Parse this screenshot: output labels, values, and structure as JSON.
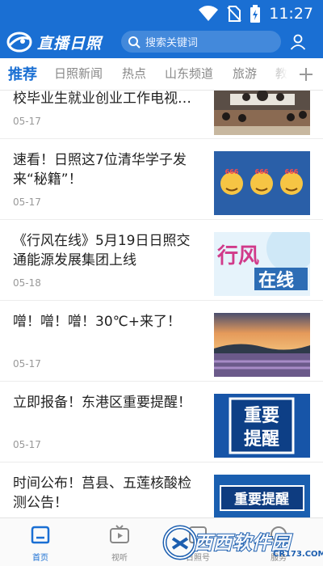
{
  "status_bar": {
    "time": "11:27"
  },
  "header": {
    "logo_text": "直播日照",
    "search_placeholder": "搜索关键词"
  },
  "tabs": [
    "推荐",
    "日照新闻",
    "热点",
    "山东频道",
    "旅游",
    "教"
  ],
  "feed": [
    {
      "title": "校毕业生就业创业工作电视…",
      "date": "05-17"
    },
    {
      "title": "速看！日照这7位清华学子发来“秘籍”！",
      "date": "05-17"
    },
    {
      "title": "《行风在线》5月19日日照交通能源发展集团上线",
      "date": "05-18"
    },
    {
      "title": "噌！噌！噌！30℃+来了！",
      "date": "05-17"
    },
    {
      "title": "立即报备！东港区重要提醒！",
      "date": "05-17"
    },
    {
      "title": "时间公布！莒县、五莲核酸检测公告！",
      "date": ""
    }
  ],
  "thumbnails": {
    "item2_badge": "666",
    "item3_text_a": "行风",
    "item3_text_b": "在线",
    "item5_text_a": "重要",
    "item5_text_b": "提醒",
    "item6_text": "重要提醒"
  },
  "bottom_nav": [
    "首页",
    "视听",
    "日照号",
    "服务"
  ],
  "watermark": {
    "text": "西西软件园",
    "url": "CR173.COM"
  },
  "colors": {
    "brand": "#1a6fd3",
    "active_tab": "#1a6fd3",
    "date": "#999999"
  }
}
